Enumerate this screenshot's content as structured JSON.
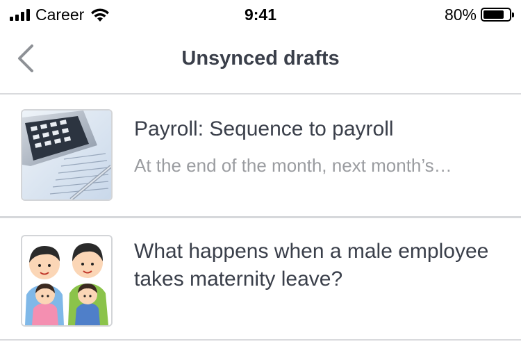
{
  "status_bar": {
    "carrier": "Career",
    "time": "9:41",
    "battery_percent": "80%",
    "battery_level": 0.8,
    "signal_icon": "signal-bars-icon",
    "wifi_icon": "wifi-icon",
    "battery_icon": "battery-icon"
  },
  "nav": {
    "title": "Unsynced drafts",
    "back_icon": "chevron-left-icon"
  },
  "drafts": [
    {
      "title": "Payroll: Sequence to payroll",
      "subtitle": "At the end of the month, next month’s…",
      "thumbnail": "calculator-image"
    },
    {
      "title": "What happens when a male employee takes maternity leave?",
      "thumbnail": "fathers-with-babies-image"
    }
  ]
}
